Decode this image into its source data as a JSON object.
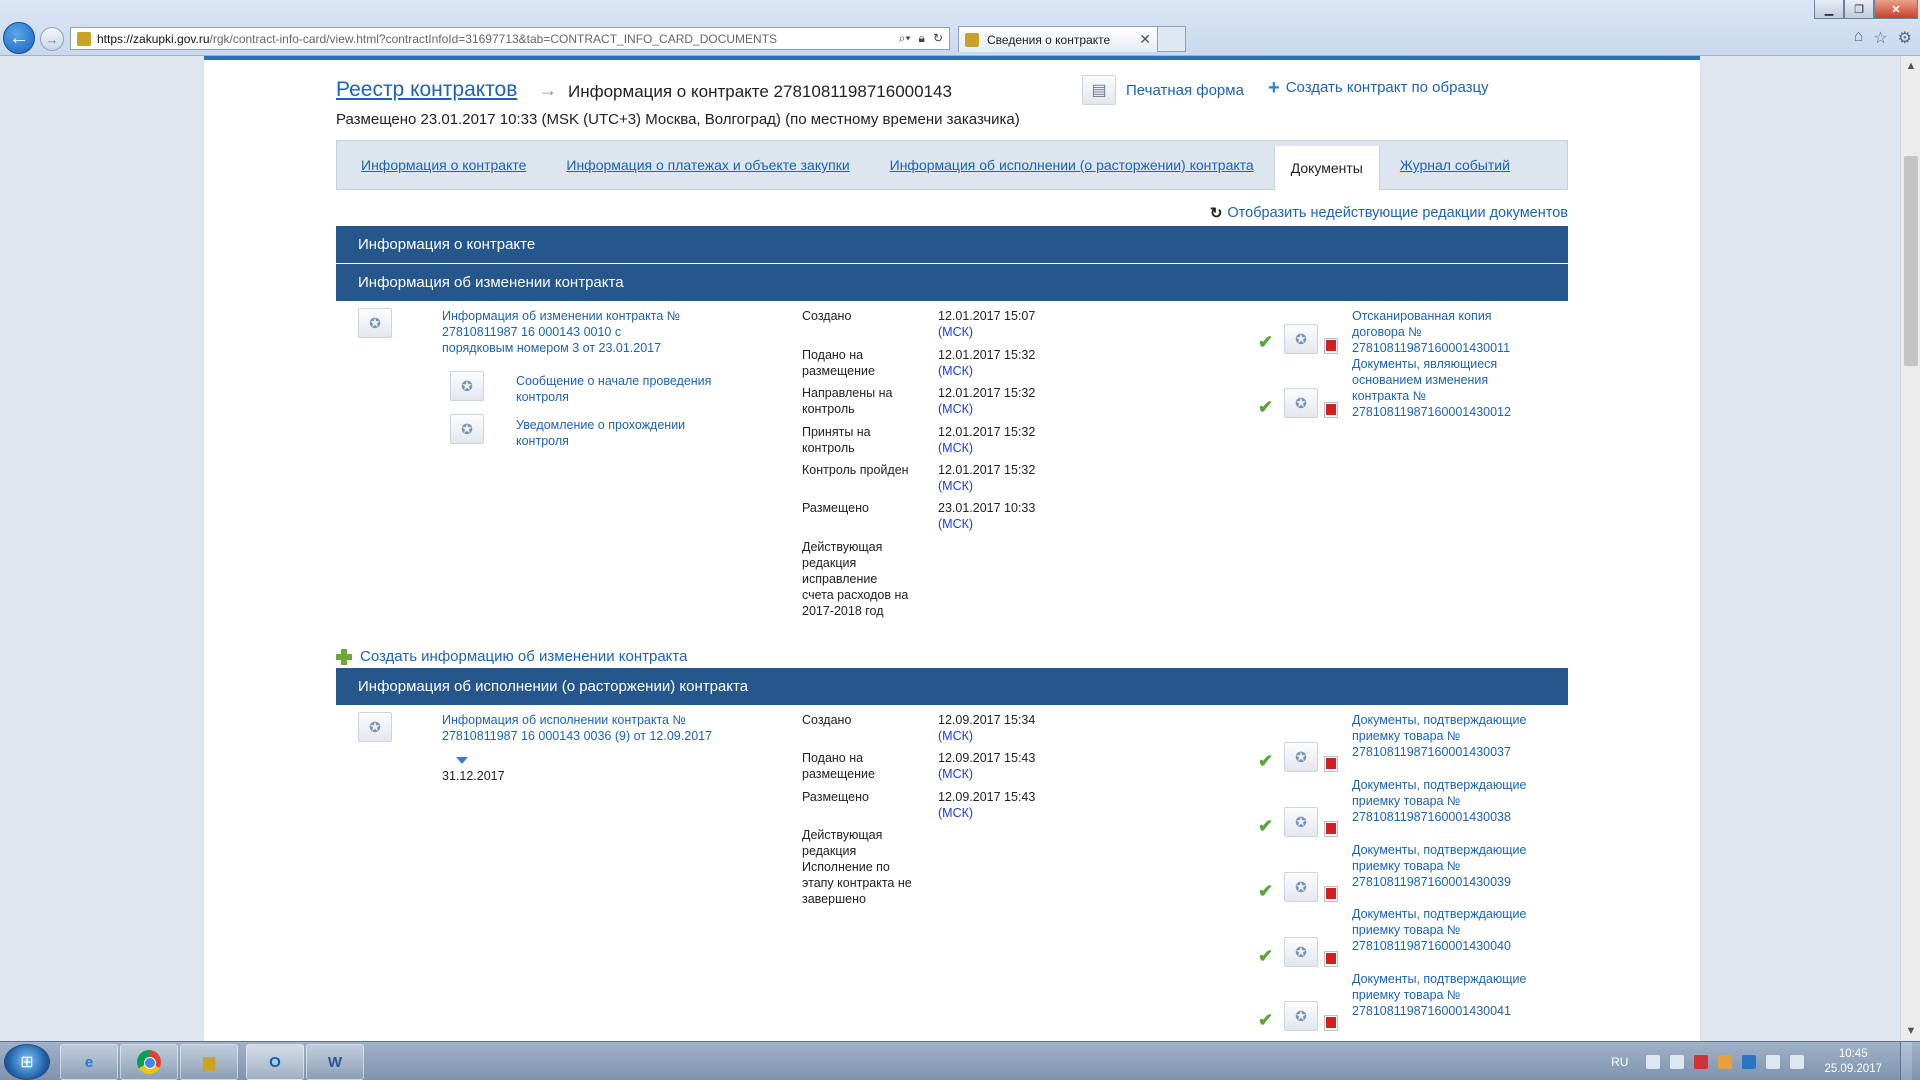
{
  "browser": {
    "url_host": "https://zakupki.gov.ru",
    "url_path": "/rgk/contract-info-card/view.html?contractInfoId=31697713&tab=CONTRACT_INFO_CARD_DOCUMENTS",
    "tab_title": "Сведения о контракте",
    "icons": [
      "back-icon",
      "forward-icon",
      "search-icon",
      "lock-icon",
      "refresh-icon",
      "close-icon",
      "home-icon",
      "star-icon",
      "gear-icon"
    ]
  },
  "header": {
    "breadcrumb": "Реестр контрактов",
    "breadcrumb_arrow": "→",
    "title": "Информация о контракте 2781081198716000143",
    "print_label": "Печатная форма",
    "create_by_template_label": "Создать контракт по образцу",
    "placed_text": "Размещено 23.01.2017 10:33 (MSK (UTC+3) Москва, Волгоград) (по местному времени заказчика)"
  },
  "tabs": [
    {
      "label": "Информация о контракте",
      "active": false
    },
    {
      "label": "Информация о платежах и объекте закупки",
      "active": false
    },
    {
      "label": "Информация об исполнении (о расторжении) контракта",
      "active": false
    },
    {
      "label": "Документы",
      "active": true
    },
    {
      "label": "Журнал событий",
      "active": false
    }
  ],
  "show_inactive_label": "Отобразить недействующие редакции документов",
  "sections": {
    "contract_info": "Информация о контракте",
    "change_info": "Информация об изменении контракта",
    "execution_info": "Информация об исполнении (о расторжении) контракта"
  },
  "change": {
    "doc_title": "Информация об изменении контракта № 27810811987 16 000143 0010 с порядковым номером 3 от 23.01.2017",
    "sub_docs": [
      "Сообщение о начале проведения контроля",
      "Уведомление о прохождении контроля"
    ],
    "statuses": [
      {
        "label": "Создано",
        "date": "12.01.2017 15:07"
      },
      {
        "label": "Подано на размещение",
        "date": "12.01.2017 15:32"
      },
      {
        "label": "Направлены на контроль",
        "date": "12.01.2017 15:32"
      },
      {
        "label": "Приняты на контроль",
        "date": "12.01.2017 15:32"
      },
      {
        "label": "Контроль пройден",
        "date": "12.01.2017 15:32"
      },
      {
        "label": "Размещено",
        "date": "23.01.2017 10:33"
      }
    ],
    "tz": "(МСК)",
    "note": "Действующая редакция исправление счета расходов на 2017-2018 год",
    "files": [
      "Отсканированная копия договора № 27810811987160001430011",
      "Документы, являющиеся основанием изменения контракта № 27810811987160001430012"
    ]
  },
  "create_change_label": "Создать информацию об изменении контракта",
  "execution": {
    "doc_title": "Информация об исполнении контракта № 27810811987 16 000143 0036 (9) от 12.09.2017",
    "date": "31.12.2017",
    "statuses": [
      {
        "label": "Создано",
        "date": "12.09.2017 15:34"
      },
      {
        "label": "Подано на размещение",
        "date": "12.09.2017 15:43"
      },
      {
        "label": "Размещено",
        "date": "12.09.2017 15:43"
      }
    ],
    "tz": "(МСК)",
    "note": "Действующая редакция Исполнение по этапу контракта не завершено",
    "files": [
      "Документы, подтверждающие приемку товара № 27810811987160001430037",
      "Документы, подтверждающие приемку товара № 27810811987160001430038",
      "Документы, подтверждающие приемку товара № 27810811987160001430039",
      "Документы, подтверждающие приемку товара № 27810811987160001430040",
      "Документы, подтверждающие приемку товара № 27810811987160001430041"
    ]
  },
  "taskbar": {
    "lang": "RU",
    "time": "10:45",
    "date": "25.09.2017"
  },
  "colors": {
    "section_bar": "#25578d",
    "link": "#1c63b4",
    "check": "#5ea33a",
    "tz": "#1a3ed6"
  }
}
